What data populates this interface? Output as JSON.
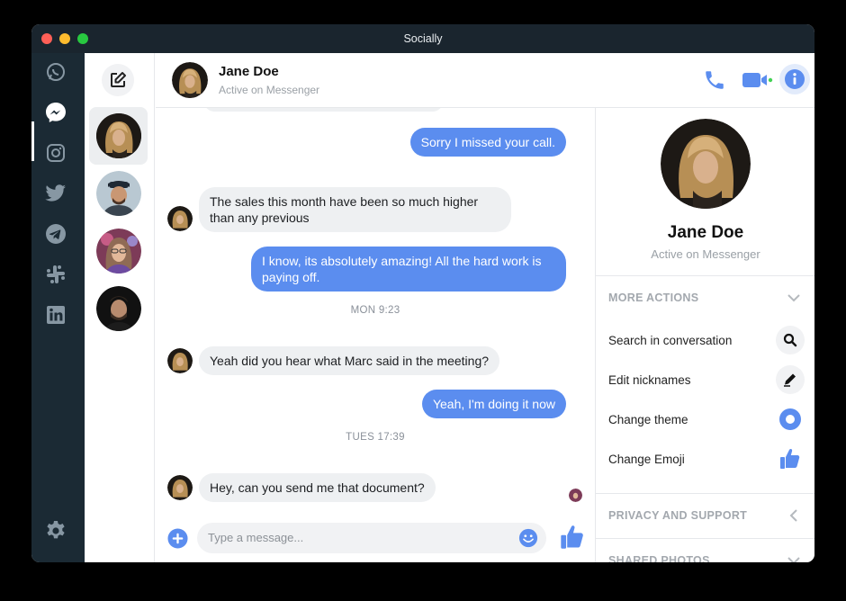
{
  "window": {
    "title": "Socially"
  },
  "apps": [
    {
      "name": "whatsapp"
    },
    {
      "name": "messenger"
    },
    {
      "name": "instagram"
    },
    {
      "name": "twitter"
    },
    {
      "name": "telegram"
    },
    {
      "name": "slack"
    },
    {
      "name": "linkedin"
    }
  ],
  "header": {
    "name": "Jane Doe",
    "status": "Active on Messenger"
  },
  "messages": [
    {
      "dir": "out",
      "text": "Sorry I missed your call."
    },
    {
      "dir": "in",
      "text": "The sales this month have been so much higher than any previous"
    },
    {
      "dir": "out",
      "text": "I know, its absolutely amazing! All the hard work is paying off."
    },
    {
      "dir": "in",
      "text": "Yeah did you hear what Marc said in the meeting?"
    },
    {
      "dir": "out",
      "text": "Yeah, I'm doing it now"
    },
    {
      "dir": "in",
      "text": "Hey, can you send me that document?"
    }
  ],
  "timestamps": [
    "MON 9:23",
    "TUES 17:39"
  ],
  "composer": {
    "placeholder": "Type a message..."
  },
  "profile": {
    "name": "Jane Doe",
    "status": "Active on Messenger"
  },
  "sections": {
    "more_actions": "MORE ACTIONS",
    "privacy": "PRIVACY AND SUPPORT",
    "shared_photos": "SHARED PHOTOS"
  },
  "actions": [
    {
      "label": "Search in conversation",
      "icon": "search-icon"
    },
    {
      "label": "Edit nicknames",
      "icon": "pencil-icon"
    },
    {
      "label": "Change theme",
      "icon": "theme-icon"
    },
    {
      "label": "Change Emoji",
      "icon": "thumbs-up-icon"
    }
  ],
  "colors": {
    "accent": "#5b8def",
    "sidebar": "#1b2a34",
    "titlebar": "#1a252e"
  }
}
